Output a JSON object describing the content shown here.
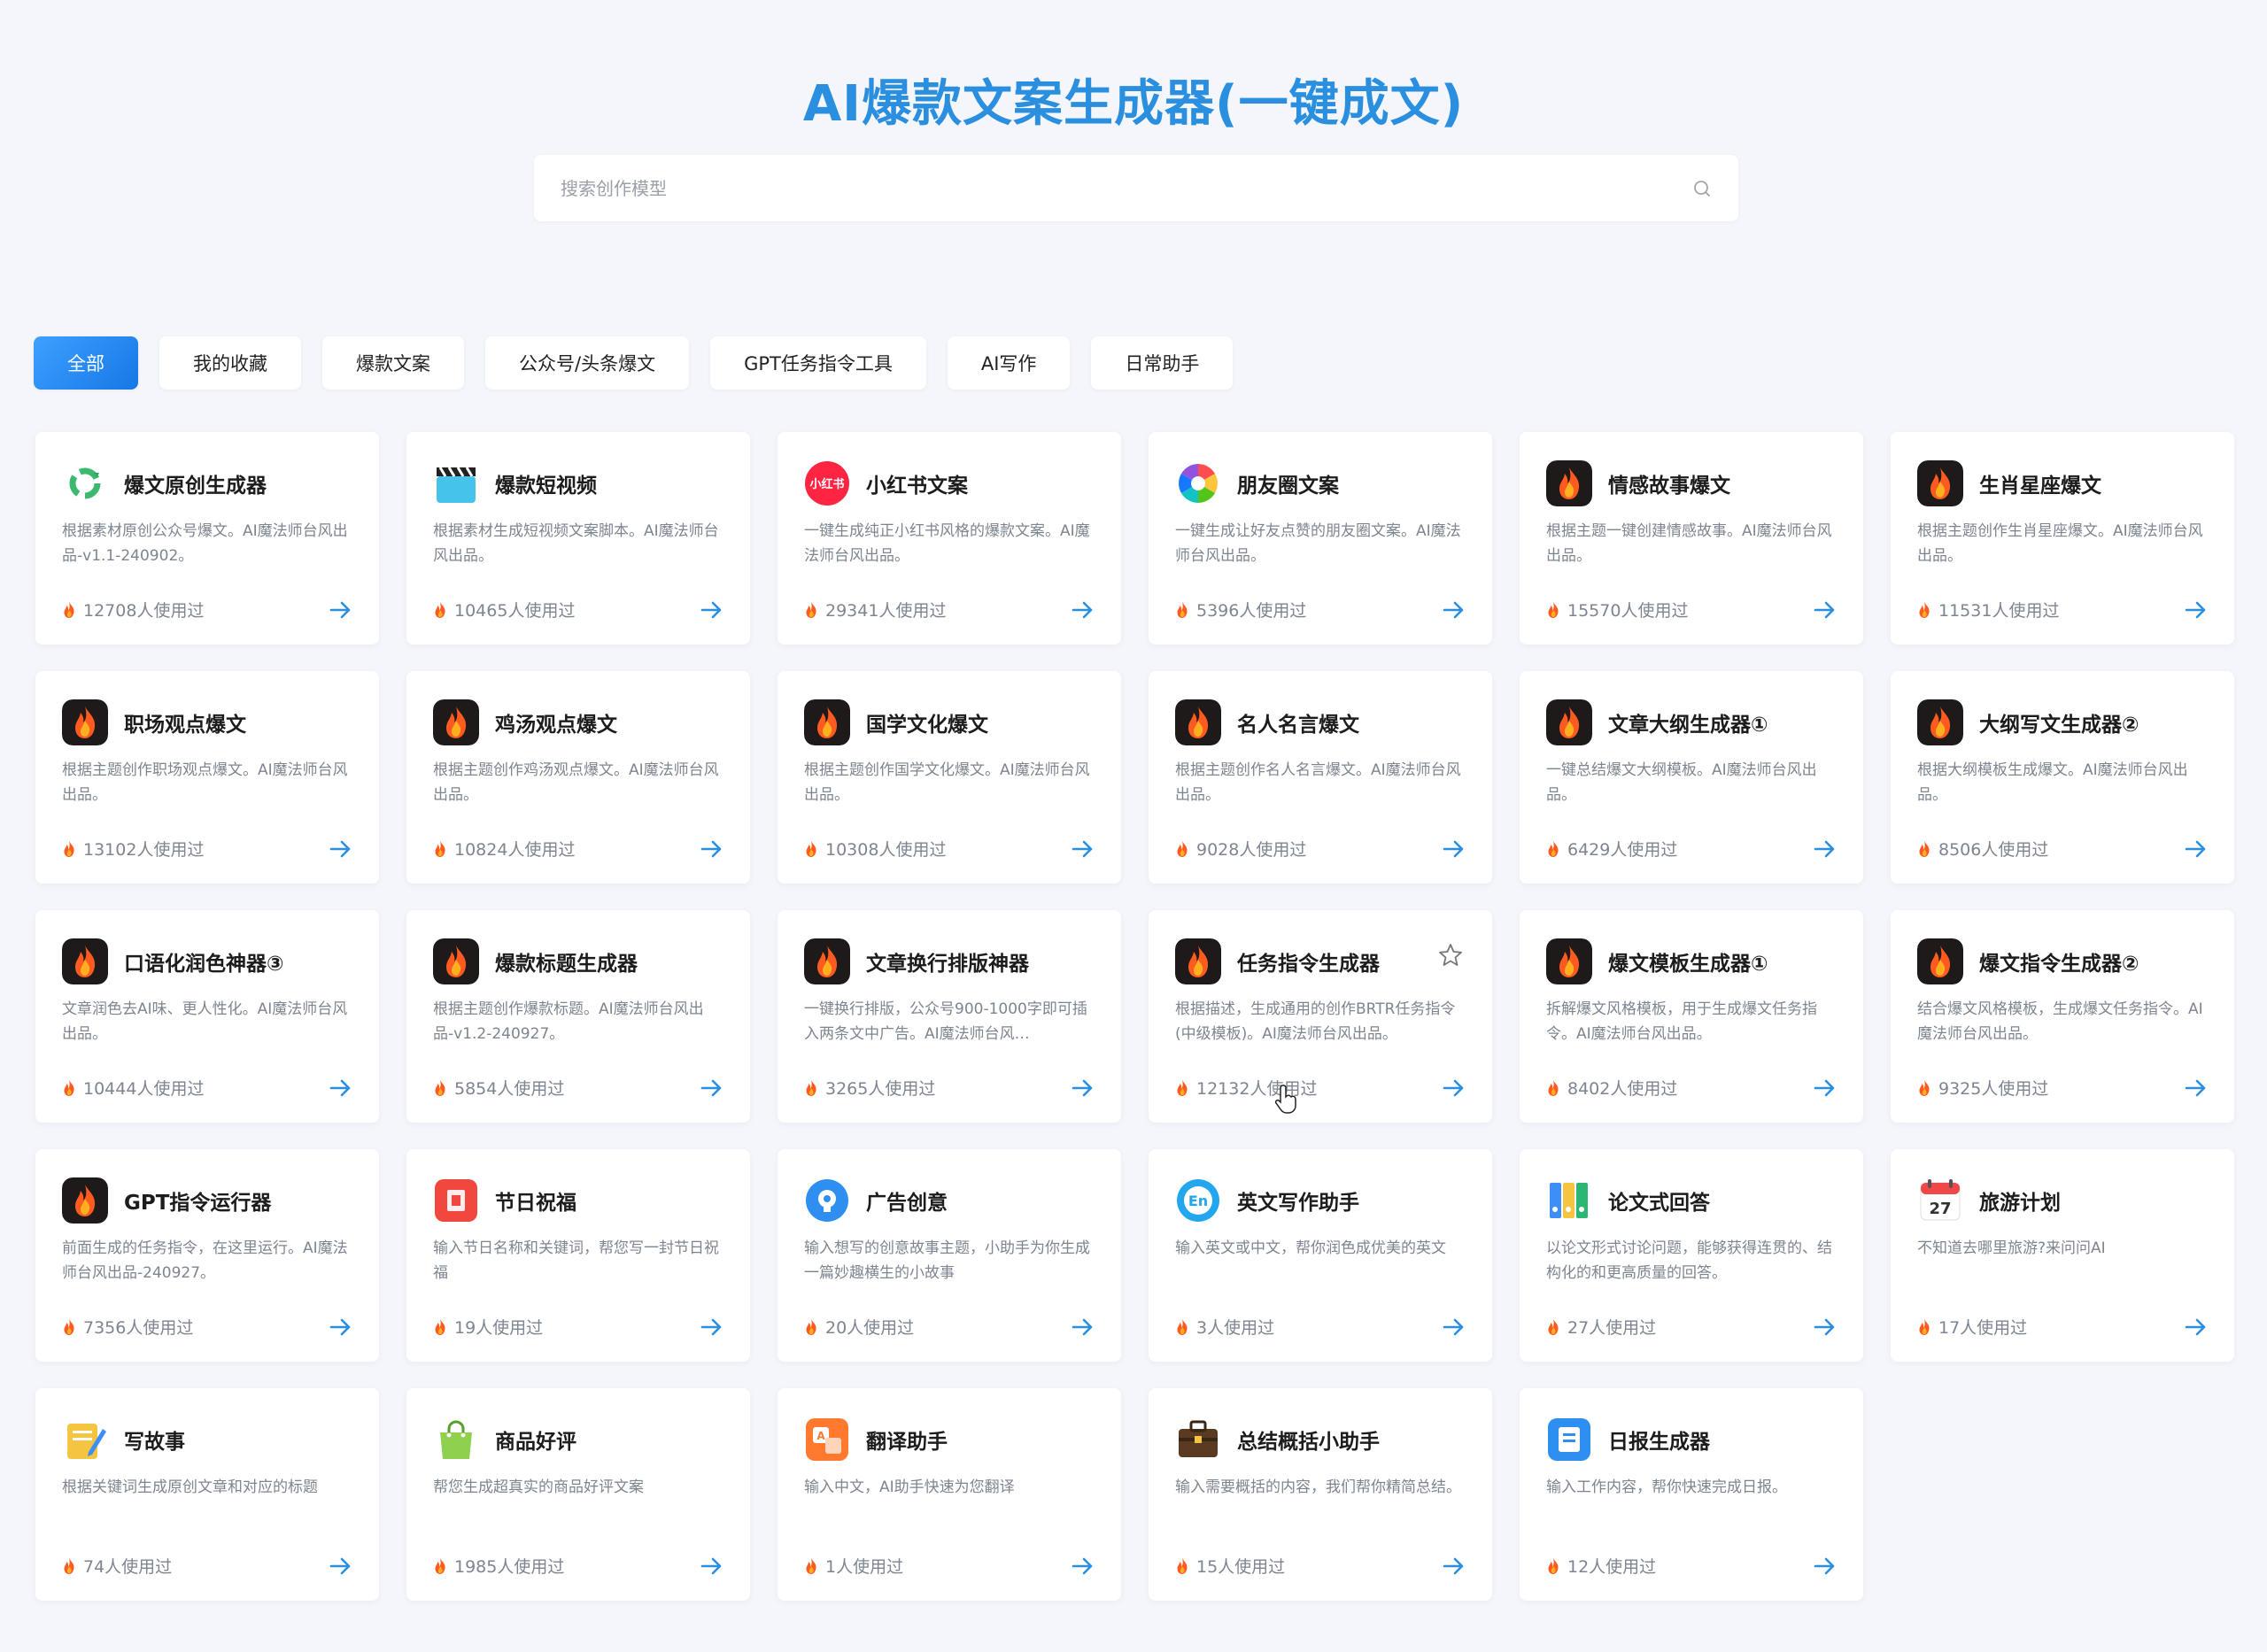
{
  "header": {
    "title": "AI爆款文案生成器(一键成文)"
  },
  "search": {
    "placeholder": "搜索创作模型",
    "icon": "search-icon"
  },
  "tabs": [
    {
      "label": "全部",
      "active": true
    },
    {
      "label": "我的收藏",
      "active": false
    },
    {
      "label": "爆款文案",
      "active": false
    },
    {
      "label": "公众号/头条爆文",
      "active": false
    },
    {
      "label": "GPT任务指令工具",
      "active": false
    },
    {
      "label": "AI写作",
      "active": false
    },
    {
      "label": "日常助手",
      "active": false
    }
  ],
  "colors": {
    "accent": "#2b8fe0",
    "tab_active": "#1677e6",
    "arrow": "#2b8fe0",
    "fire": "#ff5a1f"
  },
  "cards": [
    {
      "icon": "recycle-green-icon",
      "title": "爆文原创生成器",
      "desc": "根据素材原创公众号爆文。AI魔法师台风出品-v1.1-240902。",
      "usage": "12708人使用过"
    },
    {
      "icon": "clapperboard-icon",
      "title": "爆款短视频",
      "desc": "根据素材生成短视频文案脚本。AI魔法师台风出品。",
      "usage": "10465人使用过"
    },
    {
      "icon": "xiaohongshu-logo-icon",
      "logo_text": "小红书",
      "title": "小红书文案",
      "desc": "一键生成纯正小红书风格的爆款文案。AI魔法师台风出品。",
      "usage": "29341人使用过"
    },
    {
      "icon": "aperture-icon",
      "title": "朋友圈文案",
      "desc": "一键生成让好友点赞的朋友圈文案。AI魔法师台风出品。",
      "usage": "5396人使用过"
    },
    {
      "icon": "fire-icon",
      "title": "情感故事爆文",
      "desc": "根据主题一键创建情感故事。AI魔法师台风出品。",
      "usage": "15570人使用过"
    },
    {
      "icon": "fire-icon",
      "title": "生肖星座爆文",
      "desc": "根据主题创作生肖星座爆文。AI魔法师台风出品。",
      "usage": "11531人使用过"
    },
    {
      "icon": "fire-icon",
      "title": "职场观点爆文",
      "desc": "根据主题创作职场观点爆文。AI魔法师台风出品。",
      "usage": "13102人使用过"
    },
    {
      "icon": "fire-icon",
      "title": "鸡汤观点爆文",
      "desc": "根据主题创作鸡汤观点爆文。AI魔法师台风出品。",
      "usage": "10824人使用过"
    },
    {
      "icon": "fire-icon",
      "title": "国学文化爆文",
      "desc": "根据主题创作国学文化爆文。AI魔法师台风出品。",
      "usage": "10308人使用过"
    },
    {
      "icon": "fire-icon",
      "title": "名人名言爆文",
      "desc": "根据主题创作名人名言爆文。AI魔法师台风出品。",
      "usage": "9028人使用过"
    },
    {
      "icon": "fire-icon",
      "title": "文章大纲生成器①",
      "desc": "一键总结爆文大纲模板。AI魔法师台风出品。",
      "usage": "6429人使用过"
    },
    {
      "icon": "fire-icon",
      "title": "大纲写文生成器②",
      "desc": "根据大纲模板生成爆文。AI魔法师台风出品。",
      "usage": "8506人使用过"
    },
    {
      "icon": "fire-icon",
      "title": "口语化润色神器③",
      "desc": "文章润色去AI味、更人性化。AI魔法师台风出品。",
      "usage": "10444人使用过"
    },
    {
      "icon": "fire-icon",
      "title": "爆款标题生成器",
      "desc": "根据主题创作爆款标题。AI魔法师台风出品-v1.2-240927。",
      "usage": "5854人使用过"
    },
    {
      "icon": "fire-icon",
      "title": "文章换行排版神器",
      "desc": "一键换行排版，公众号900-1000字即可插入两条文中广告。AI魔法师台风…",
      "usage": "3265人使用过"
    },
    {
      "icon": "fire-icon",
      "title": "任务指令生成器",
      "desc": "根据描述，生成通用的创作BRTR任务指令(中级模板)。AI魔法师台风出品。",
      "usage": "12132人使用过",
      "favorite_icon": "star-outline-icon"
    },
    {
      "icon": "fire-icon",
      "title": "爆文模板生成器①",
      "desc": "拆解爆文风格模板，用于生成爆文任务指令。AI魔法师台风出品。",
      "usage": "8402人使用过"
    },
    {
      "icon": "fire-icon",
      "title": "爆文指令生成器②",
      "desc": "结合爆文风格模板，生成爆文任务指令。AI魔法师台风出品。",
      "usage": "9325人使用过"
    },
    {
      "icon": "fire-icon",
      "title": "GPT指令运行器",
      "desc": "前面生成的任务指令，在这里运行。AI魔法师台风出品-240927。",
      "usage": "7356人使用过"
    },
    {
      "icon": "red-envelope-icon",
      "title": "节日祝福",
      "desc": "输入节日名称和关键词，帮您写一封节日祝福",
      "usage": "19人使用过"
    },
    {
      "icon": "lightbulb-gear-icon",
      "title": "广告创意",
      "desc": "输入想写的创意故事主题，小助手为你生成一篇妙趣横生的小故事",
      "usage": "20人使用过"
    },
    {
      "icon": "en-badge-icon",
      "logo_text": "En",
      "title": "英文写作助手",
      "desc": "输入英文或中文，帮你润色成优美的英文",
      "usage": "3人使用过"
    },
    {
      "icon": "binders-icon",
      "title": "论文式回答",
      "desc": "以论文形式讨论问题，能够获得连贯的、结构化的和更高质量的回答。",
      "usage": "27人使用过"
    },
    {
      "icon": "calendar-icon",
      "logo_text": "27",
      "title": "旅游计划",
      "desc": "不知道去哪里旅游?来问问AI",
      "usage": "17人使用过"
    },
    {
      "icon": "pencil-paper-icon",
      "title": "写故事",
      "desc": "根据关键词生成原创文章和对应的标题",
      "usage": "74人使用过"
    },
    {
      "icon": "shopping-bag-icon",
      "title": "商品好评",
      "desc": "帮您生成超真实的商品好评文案",
      "usage": "1985人使用过"
    },
    {
      "icon": "translate-icon",
      "title": "翻译助手",
      "desc": "输入中文，AI助手快速为您翻译",
      "usage": "1人使用过"
    },
    {
      "icon": "briefcase-icon",
      "title": "总结概括小助手",
      "desc": "输入需要概括的内容，我们帮你精简总结。",
      "usage": "15人使用过"
    },
    {
      "icon": "daily-report-icon",
      "title": "日报生成器",
      "desc": "输入工作内容，帮你快速完成日报。",
      "usage": "12人使用过"
    }
  ]
}
